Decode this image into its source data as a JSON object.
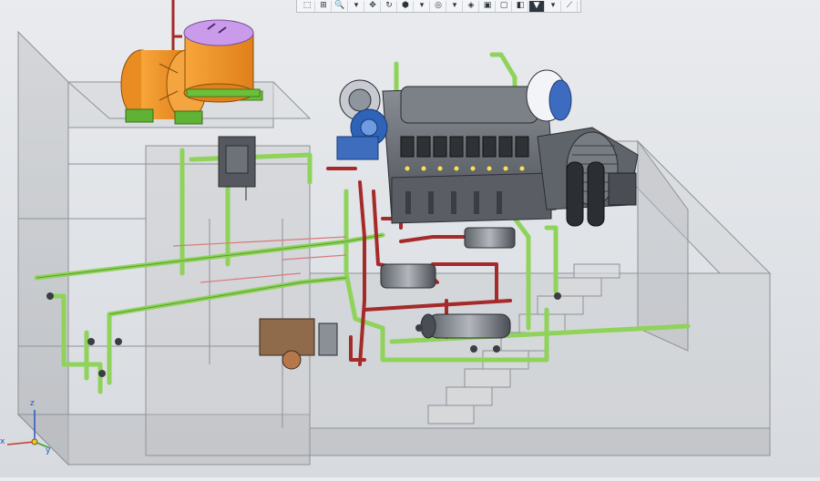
{
  "toolbar": {
    "buttons": [
      {
        "name": "select-icon",
        "glyph": "⬚"
      },
      {
        "name": "view-icon",
        "glyph": "⊞"
      },
      {
        "name": "zoom-icon",
        "glyph": "🔍"
      },
      {
        "name": "zoom-dropdown-icon",
        "glyph": "▾"
      },
      {
        "name": "pan-icon",
        "glyph": "✥"
      },
      {
        "name": "rotate-icon",
        "glyph": "↻"
      },
      {
        "name": "orientation-icon",
        "glyph": "⬢"
      },
      {
        "name": "orientation-dropdown-icon",
        "glyph": "▾"
      },
      {
        "name": "section-icon",
        "glyph": "◎"
      },
      {
        "name": "section-dropdown-icon",
        "glyph": "▾"
      },
      {
        "name": "display-mode-icon",
        "glyph": "◈"
      },
      {
        "name": "shading-icon",
        "glyph": "▣"
      },
      {
        "name": "wireframe-icon",
        "glyph": "▢"
      },
      {
        "name": "perspective-icon",
        "glyph": "◧"
      },
      {
        "name": "filter-icon",
        "glyph": "▼"
      },
      {
        "name": "filter-dropdown-icon",
        "glyph": "▾"
      },
      {
        "name": "measure-icon",
        "glyph": "⟋"
      }
    ]
  },
  "colors": {
    "pipe_green": "#8fd35a",
    "pipe_red": "#a52a2a",
    "tank_orange": "#f0962a",
    "tank_lid": "#c99bea",
    "engine_gray": "#6f747b",
    "building_gray": "#b9bcc0"
  },
  "triad": {
    "x_label": "x",
    "y_label": "y",
    "z_label": "z"
  }
}
